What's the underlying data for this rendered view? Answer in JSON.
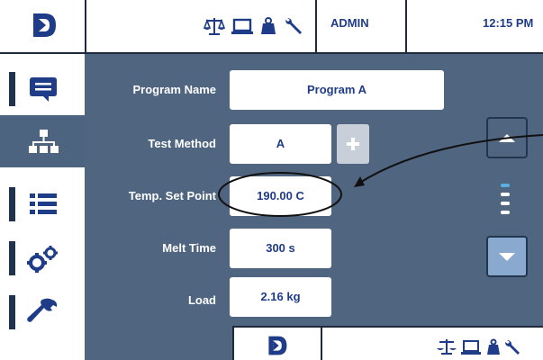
{
  "header": {
    "user": "ADMIN",
    "time": "12:15 PM",
    "icons": [
      "balance-scale-icon",
      "laptop-icon",
      "weight-icon",
      "wrench-icon"
    ]
  },
  "sidebar": {
    "tabs": [
      {
        "icon": "message-icon",
        "active": false
      },
      {
        "icon": "sitemap-icon",
        "active": true
      },
      {
        "icon": "list-icon",
        "active": false
      },
      {
        "icon": "gears-icon",
        "active": false
      },
      {
        "icon": "wrench-icon",
        "active": false
      }
    ]
  },
  "form": {
    "program_name_label": "Program Name",
    "program_name_value": "Program A",
    "test_method_label": "Test Method",
    "test_method_value": "A",
    "temp_label": "Temp. Set Point",
    "temp_value": "190.00 C",
    "melt_time_label": "Melt Time",
    "melt_time_value": "300 s",
    "load_label": "Load",
    "load_value": "2.16 kg"
  },
  "colors": {
    "panel": "#4f6580",
    "accent": "#1f3c88",
    "scroll_down": "#8aa9cf",
    "scroll_indicator": "#5aaee0"
  }
}
